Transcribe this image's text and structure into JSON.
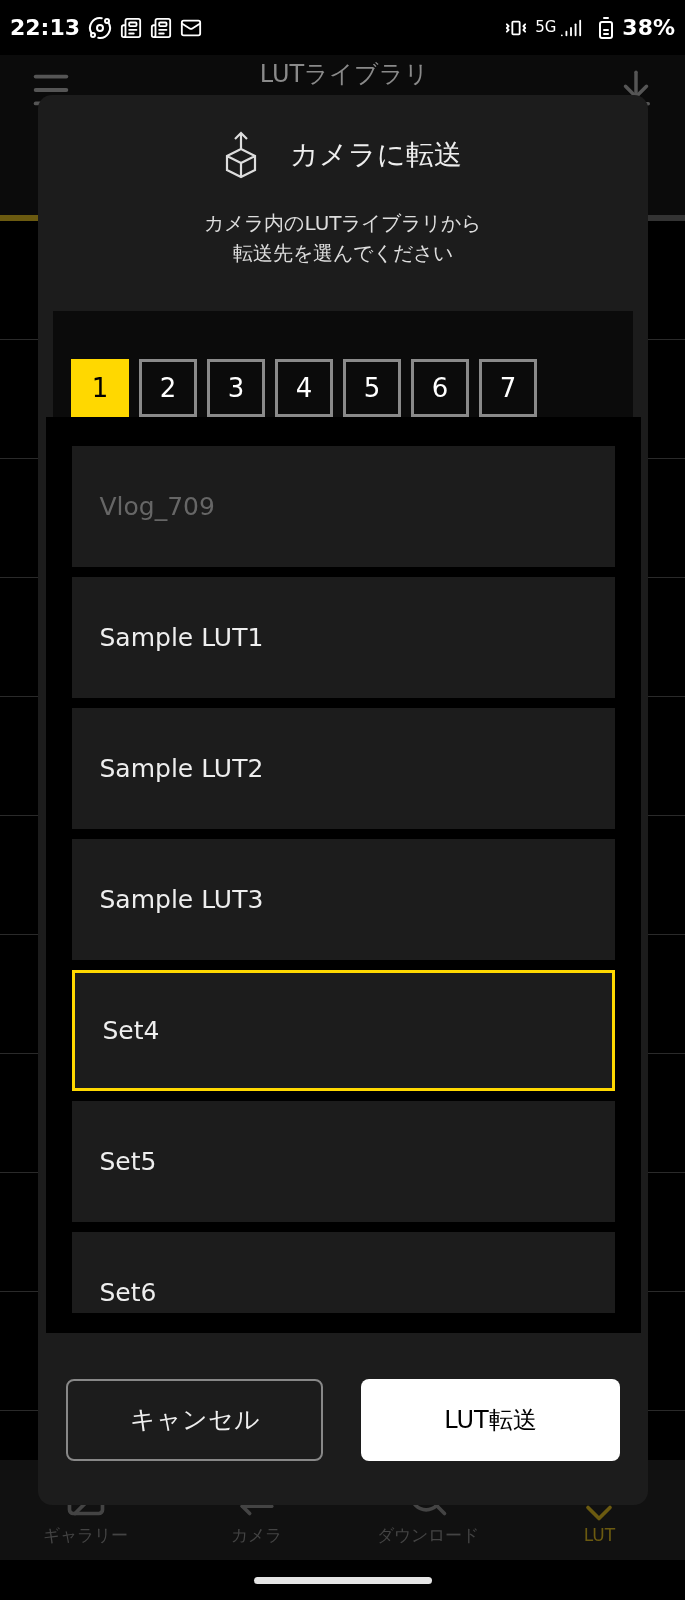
{
  "status_bar": {
    "time": "22:13",
    "network": "5G",
    "battery": "38%"
  },
  "header": {
    "title": "LUTライブラリ"
  },
  "dialog": {
    "title": "カメラに転送",
    "message": [
      "カメラ内のLUTライブラリから",
      "転送先を選んでください"
    ],
    "slots": [
      {
        "label": "1",
        "selected": true
      },
      {
        "label": "2",
        "selected": false
      },
      {
        "label": "3",
        "selected": false
      },
      {
        "label": "4",
        "selected": false
      },
      {
        "label": "5",
        "selected": false
      },
      {
        "label": "6",
        "selected": false
      },
      {
        "label": "7",
        "selected": false
      }
    ],
    "luts": [
      {
        "name": "Vlog_709",
        "disabled": true,
        "selected": false
      },
      {
        "name": "Sample LUT1",
        "disabled": false,
        "selected": false
      },
      {
        "name": "Sample LUT2",
        "disabled": false,
        "selected": false
      },
      {
        "name": "Sample LUT3",
        "disabled": false,
        "selected": false
      },
      {
        "name": "Set4",
        "disabled": false,
        "selected": true
      },
      {
        "name": "Set5",
        "disabled": false,
        "selected": false
      },
      {
        "name": "Set6",
        "disabled": false,
        "selected": false
      }
    ],
    "buttons": [
      {
        "label": "キャンセル",
        "kind": "secondary"
      },
      {
        "label": "LUT転送",
        "kind": "primary"
      }
    ]
  },
  "bottom_nav": [
    {
      "label": "ギャラリー",
      "kind": "gallery",
      "selected": false
    },
    {
      "label": "カメラ",
      "kind": "camera",
      "selected": false
    },
    {
      "label": "ダウンロード",
      "kind": "download",
      "selected": false
    },
    {
      "label": "LUT",
      "kind": "lut",
      "selected": true
    }
  ]
}
